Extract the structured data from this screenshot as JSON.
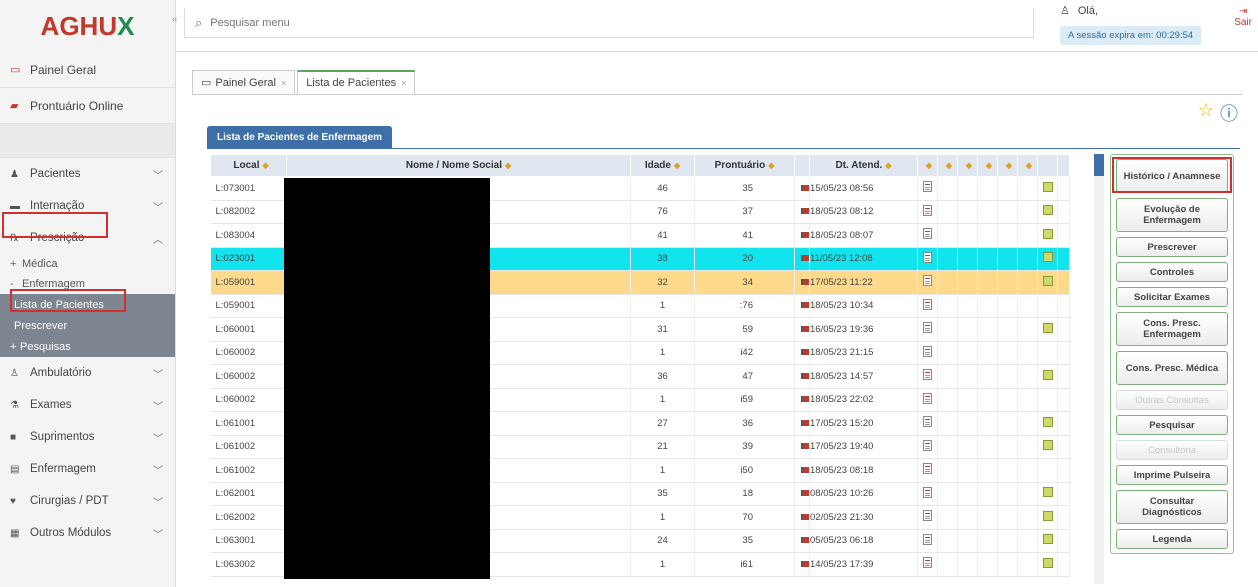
{
  "app": {
    "logo_prefix": "AGHU",
    "logo_x": "X"
  },
  "header": {
    "search_placeholder": "Pesquisar menu",
    "greeting": "Olá,",
    "session_text": "A sessão expira em: 00:29:54",
    "logout_label": "Sair"
  },
  "sidebar": {
    "top": [
      {
        "label": "Painel Geral",
        "icon": "monitor-icon"
      },
      {
        "label": "Prontuário Online",
        "icon": "folder-icon"
      }
    ],
    "items": [
      {
        "label": "Pacientes",
        "icon": "users-icon"
      },
      {
        "label": "Internação",
        "icon": "bed-icon"
      },
      {
        "label": "Prescrição",
        "icon": "prescription-icon"
      }
    ],
    "prescricao_sub": {
      "medica": "Médica",
      "enfermagem": "Enfermagem",
      "lista": "Lista de Pacientes",
      "prescrever": "Prescrever",
      "pesquisas": "Pesquisas"
    },
    "items_after": [
      {
        "label": "Ambulatório",
        "icon": "stethoscope-icon"
      },
      {
        "label": "Exames",
        "icon": "flask-icon"
      },
      {
        "label": "Suprimentos",
        "icon": "box-icon"
      },
      {
        "label": "Enfermagem",
        "icon": "nursing-icon"
      },
      {
        "label": "Cirurgias / PDT",
        "icon": "surgery-icon"
      },
      {
        "label": "Outros Módulos",
        "icon": "grid-icon"
      }
    ]
  },
  "tabs": [
    {
      "label": "Painel Geral",
      "active": false
    },
    {
      "label": "Lista de Pacientes",
      "active": true
    }
  ],
  "panel": {
    "title": "Lista de Pacientes de Enfermagem"
  },
  "table": {
    "headers": {
      "local": "Local",
      "nome": "Nome / Nome Social",
      "idade": "Idade",
      "prontuario": "Prontuário",
      "dt": "Dt. Atend."
    },
    "rows": [
      {
        "local": "L:073001",
        "idade": "46",
        "pront": "35",
        "dt": "15/05/23 08:56",
        "chk": true,
        "hl": ""
      },
      {
        "local": "L:082002",
        "idade": "76",
        "pront": "37",
        "dt": "18/05/23 08:12",
        "chk": true,
        "hl": ""
      },
      {
        "local": "L:083004",
        "idade": "41",
        "pront": "41",
        "dt": "18/05/23 08:07",
        "chk": true,
        "hl": ""
      },
      {
        "local": "L:023001",
        "idade": "38",
        "pront": "20",
        "dt": "11/05/23 12:08",
        "chk": true,
        "hl": "cyan"
      },
      {
        "local": "L:059001",
        "idade": "32",
        "pront": "34",
        "dt": "17/05/23 11:22",
        "chk": true,
        "hl": "orange"
      },
      {
        "local": "L:059001",
        "idade": "1",
        "pront": ":76",
        "dt": "18/05/23 10:34",
        "chk": false,
        "hl": ""
      },
      {
        "local": "L:060001",
        "idade": "31",
        "pront": "59",
        "dt": "16/05/23 19:36",
        "chk": true,
        "hl": ""
      },
      {
        "local": "L:060002",
        "idade": "1",
        "pront": "i42",
        "dt": "18/05/23 21:15",
        "chk": false,
        "hl": ""
      },
      {
        "local": "L:060002",
        "idade": "36",
        "pront": "47",
        "dt": "18/05/23 14:57",
        "chk": true,
        "hl": ""
      },
      {
        "local": "L:060002",
        "idade": "1",
        "pront": "i59",
        "dt": "18/05/23 22:02",
        "chk": false,
        "hl": ""
      },
      {
        "local": "L:061001",
        "idade": "27",
        "pront": "36",
        "dt": "17/05/23 15:20",
        "chk": true,
        "hl": ""
      },
      {
        "local": "L:061002",
        "idade": "21",
        "pront": "39",
        "dt": "17/05/23 19:40",
        "chk": true,
        "hl": ""
      },
      {
        "local": "L:061002",
        "idade": "1",
        "pront": "i50",
        "dt": "18/05/23 08:18",
        "chk": false,
        "hl": ""
      },
      {
        "local": "L:062001",
        "idade": "35",
        "pront": "18",
        "dt": "08/05/23 10:26",
        "chk": true,
        "hl": ""
      },
      {
        "local": "L:062002",
        "idade": "1",
        "pront": "70",
        "dt": "02/05/23 21:30",
        "chk": true,
        "hl": ""
      },
      {
        "local": "L:063001",
        "idade": "24",
        "pront": "35",
        "dt": "05/05/23 06:18",
        "chk": true,
        "hl": ""
      },
      {
        "local": "L:063002",
        "idade": "1",
        "pront": "i61",
        "dt": "14/05/23 17:39",
        "chk": true,
        "hl": ""
      }
    ]
  },
  "actions": [
    {
      "label": "Histórico / Anamnese",
      "enabled": true
    },
    {
      "label": "Evolução de Enfermagem",
      "enabled": true
    },
    {
      "label": "Prescrever",
      "enabled": true
    },
    {
      "label": "Controles",
      "enabled": true
    },
    {
      "label": "Solicitar Exames",
      "enabled": true
    },
    {
      "label": "Cons. Presc. Enfermagem",
      "enabled": true
    },
    {
      "label": "Cons. Presc. Médica",
      "enabled": true
    },
    {
      "label": "Outras Consultas",
      "enabled": false
    },
    {
      "label": "Pesquisar",
      "enabled": true
    },
    {
      "label": "Consultoria",
      "enabled": false
    },
    {
      "label": "Imprime Pulseira",
      "enabled": true
    },
    {
      "label": "Consultar Diagnósticos",
      "enabled": true
    },
    {
      "label": "Legenda",
      "enabled": true
    }
  ],
  "colors": {
    "accent": "#3e6fa8",
    "highlight_cyan": "#12e4ee",
    "highlight_orange": "#fdd98b",
    "annotation_red": "#d32f2f"
  }
}
